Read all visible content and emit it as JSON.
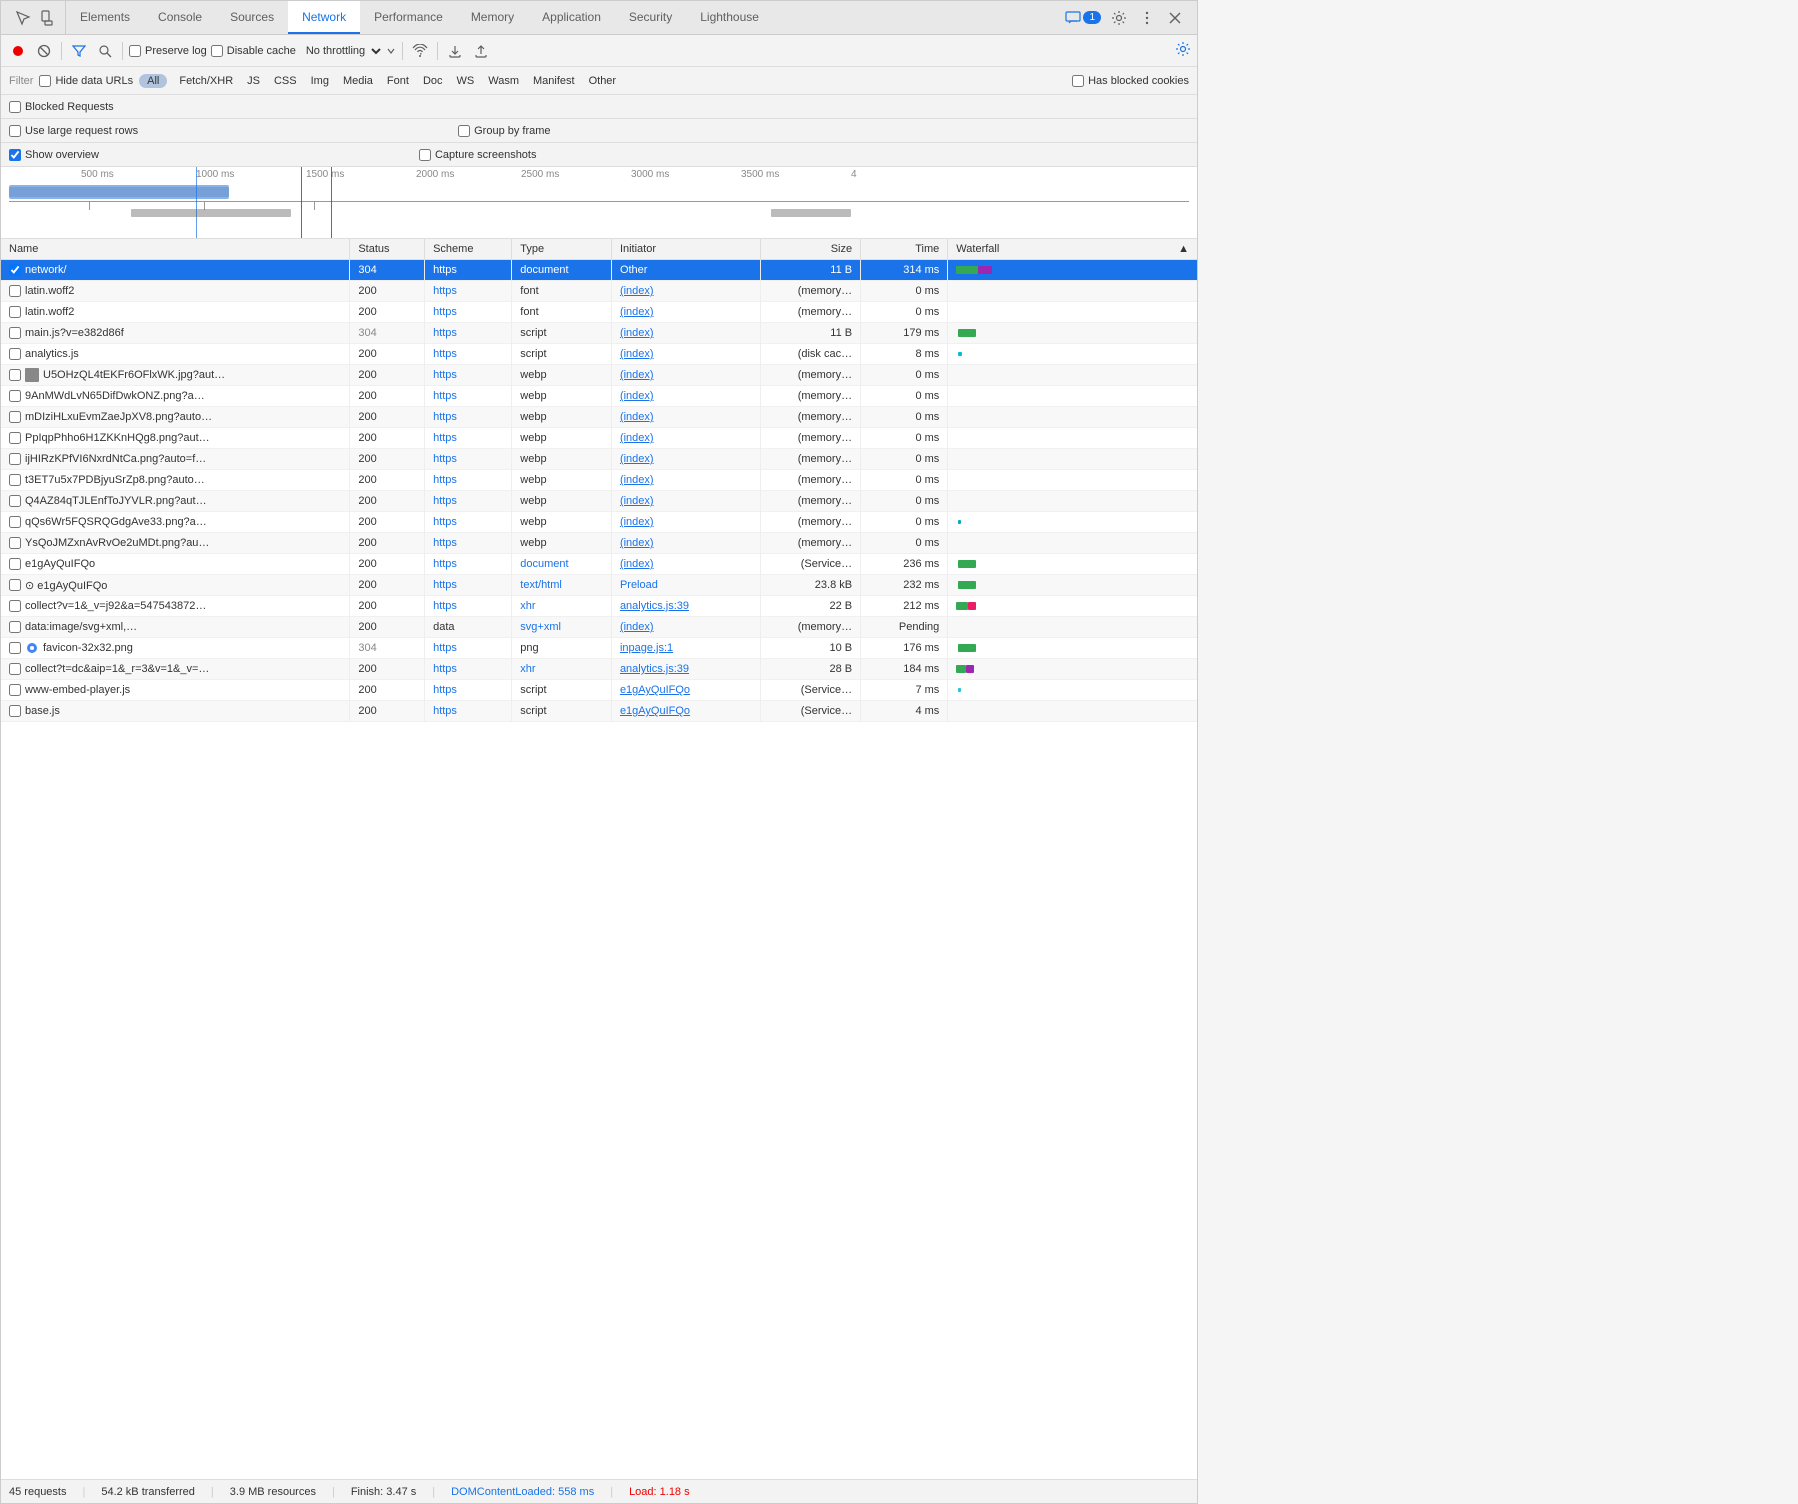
{
  "tabs": {
    "items": [
      {
        "label": "Elements",
        "active": false
      },
      {
        "label": "Console",
        "active": false
      },
      {
        "label": "Sources",
        "active": false
      },
      {
        "label": "Network",
        "active": true
      },
      {
        "label": "Performance",
        "active": false
      },
      {
        "label": "Memory",
        "active": false
      },
      {
        "label": "Application",
        "active": false
      },
      {
        "label": "Security",
        "active": false
      },
      {
        "label": "Lighthouse",
        "active": false
      }
    ],
    "badge": "1",
    "settings_title": "Settings",
    "more_title": "More options",
    "close_title": "Close DevTools"
  },
  "toolbar": {
    "record_tooltip": "Stop recording network log",
    "clear_tooltip": "Clear",
    "filter_tooltip": "Filter",
    "search_tooltip": "Search",
    "preserve_log": "Preserve log",
    "disable_cache": "Disable cache",
    "throttle_label": "No throttling",
    "online_icon_tooltip": "Network conditions",
    "import_tooltip": "Import HAR file",
    "export_tooltip": "Export HAR"
  },
  "filter_bar": {
    "label": "Filter",
    "hide_data_urls": "Hide data URLs",
    "types": [
      "Fetch/XHR",
      "JS",
      "CSS",
      "Img",
      "Media",
      "Font",
      "Doc",
      "WS",
      "Wasm",
      "Manifest",
      "Other"
    ],
    "all_label": "All",
    "has_blocked_cookies": "Has blocked cookies",
    "blocked_requests": "Blocked Requests"
  },
  "options": {
    "use_large_rows": "Use large request rows",
    "group_by_frame": "Group by frame",
    "show_overview": "Show overview",
    "capture_screenshots": "Capture screenshots"
  },
  "timeline": {
    "labels": [
      "500 ms",
      "1000 ms",
      "1500 ms",
      "2000 ms",
      "2500 ms",
      "3000 ms",
      "3500 ms",
      "4"
    ]
  },
  "table": {
    "columns": [
      "Name",
      "Status",
      "Scheme",
      "Type",
      "Initiator",
      "Size",
      "Time",
      "Waterfall"
    ],
    "rows": [
      {
        "name": "network/",
        "status": "304",
        "scheme": "https",
        "type": "document",
        "initiator": "Other",
        "size": "11 B",
        "time": "314 ms",
        "waterfall_type": "green-purple",
        "selected": true,
        "has_icon": true
      },
      {
        "name": "latin.woff2",
        "status": "200",
        "scheme": "https",
        "type": "font",
        "initiator": "(index)",
        "size": "(memory…",
        "time": "0 ms",
        "waterfall_type": "none",
        "selected": false
      },
      {
        "name": "latin.woff2",
        "status": "200",
        "scheme": "https",
        "type": "font",
        "initiator": "(index)",
        "size": "(memory…",
        "time": "0 ms",
        "waterfall_type": "none",
        "selected": false
      },
      {
        "name": "main.js?v=e382d86f",
        "status": "304",
        "scheme": "https",
        "type": "script",
        "initiator": "(index)",
        "size": "11 B",
        "time": "179 ms",
        "waterfall_type": "green",
        "selected": false
      },
      {
        "name": "analytics.js",
        "status": "200",
        "scheme": "https",
        "type": "script",
        "initiator": "(index)",
        "size": "(disk cac…",
        "time": "8 ms",
        "waterfall_type": "teal",
        "selected": false
      },
      {
        "name": "U5OHzQL4tEKFr6OFlxWK.jpg?aut…",
        "status": "200",
        "scheme": "https",
        "type": "webp",
        "initiator": "(index)",
        "size": "(memory…",
        "time": "0 ms",
        "waterfall_type": "none",
        "selected": false,
        "has_thumbnail": true
      },
      {
        "name": "9AnMWdLvN65DifDwkONZ.png?a…",
        "status": "200",
        "scheme": "https",
        "type": "webp",
        "initiator": "(index)",
        "size": "(memory…",
        "time": "0 ms",
        "waterfall_type": "none",
        "selected": false
      },
      {
        "name": "mDIziHLxuEvmZaeJpXV8.png?auto…",
        "status": "200",
        "scheme": "https",
        "type": "webp",
        "initiator": "(index)",
        "size": "(memory…",
        "time": "0 ms",
        "waterfall_type": "none",
        "selected": false
      },
      {
        "name": "PpIqpPhho6H1ZKKnHQg8.png?aut…",
        "status": "200",
        "scheme": "https",
        "type": "webp",
        "initiator": "(index)",
        "size": "(memory…",
        "time": "0 ms",
        "waterfall_type": "none",
        "selected": false
      },
      {
        "name": "ijHIRzKPfVI6NxrdNtCa.png?auto=f…",
        "status": "200",
        "scheme": "https",
        "type": "webp",
        "initiator": "(index)",
        "size": "(memory…",
        "time": "0 ms",
        "waterfall_type": "none",
        "selected": false
      },
      {
        "name": "t3ET7u5x7PDBjyuSrZp8.png?auto…",
        "status": "200",
        "scheme": "https",
        "type": "webp",
        "initiator": "(index)",
        "size": "(memory…",
        "time": "0 ms",
        "waterfall_type": "none",
        "selected": false
      },
      {
        "name": "Q4AZ84qTJLEnfToJYVLR.png?aut…",
        "status": "200",
        "scheme": "https",
        "type": "webp",
        "initiator": "(index)",
        "size": "(memory…",
        "time": "0 ms",
        "waterfall_type": "none",
        "selected": false
      },
      {
        "name": "qQs6Wr5FQSRQGdgAve33.png?a…",
        "status": "200",
        "scheme": "https",
        "type": "webp",
        "initiator": "(index)",
        "size": "(memory…",
        "time": "0 ms",
        "waterfall_type": "teal-small",
        "selected": false
      },
      {
        "name": "YsQoJMZxnAvRvOe2uMDt.png?au…",
        "status": "200",
        "scheme": "https",
        "type": "webp",
        "initiator": "(index)",
        "size": "(memory…",
        "time": "0 ms",
        "waterfall_type": "none",
        "selected": false
      },
      {
        "name": "e1gAyQuIFQo",
        "status": "200",
        "scheme": "https",
        "type": "document",
        "initiator": "(index)",
        "size": "(Service…",
        "time": "236 ms",
        "waterfall_type": "green",
        "selected": false
      },
      {
        "name": "⊙ e1gAyQuIFQo",
        "status": "200",
        "scheme": "https",
        "type": "text/html",
        "initiator": "Preload",
        "size": "23.8 kB",
        "time": "232 ms",
        "waterfall_type": "green",
        "selected": false
      },
      {
        "name": "collect?v=1&_v=j92&a=547543872…",
        "status": "200",
        "scheme": "https",
        "type": "xhr",
        "initiator": "analytics.js:39",
        "size": "22 B",
        "time": "212 ms",
        "waterfall_type": "green-purple2",
        "selected": false
      },
      {
        "name": "data:image/svg+xml,…",
        "status": "200",
        "scheme": "data",
        "type": "svg+xml",
        "initiator": "(index)",
        "size": "(memory…",
        "time": "Pending",
        "waterfall_type": "none",
        "selected": false
      },
      {
        "name": "favicon-32x32.png",
        "status": "304",
        "scheme": "https",
        "type": "png",
        "initiator": "inpage.js:1",
        "size": "10 B",
        "time": "176 ms",
        "waterfall_type": "green",
        "selected": false,
        "has_favicon": true
      },
      {
        "name": "collect?t=dc&aip=1&_r=3&v=1&_v=…",
        "status": "200",
        "scheme": "https",
        "type": "xhr",
        "initiator": "analytics.js:39",
        "size": "28 B",
        "time": "184 ms",
        "waterfall_type": "green-purple3",
        "selected": false
      },
      {
        "name": "www-embed-player.js",
        "status": "200",
        "scheme": "https",
        "type": "script",
        "initiator": "e1gAyQuIFQo",
        "size": "(Service…",
        "time": "7 ms",
        "waterfall_type": "teal-small2",
        "selected": false
      },
      {
        "name": "base.js",
        "status": "200",
        "scheme": "https",
        "type": "script",
        "initiator": "e1gAyQuIFQo",
        "size": "(Service…",
        "time": "4 ms",
        "waterfall_type": "none",
        "selected": false
      }
    ]
  },
  "status_bar": {
    "requests": "45 requests",
    "transferred": "54.2 kB transferred",
    "resources": "3.9 MB resources",
    "finish": "Finish: 3.47 s",
    "dom_content_loaded": "DOMContentLoaded: 558 ms",
    "load": "Load: 1.18 s"
  }
}
